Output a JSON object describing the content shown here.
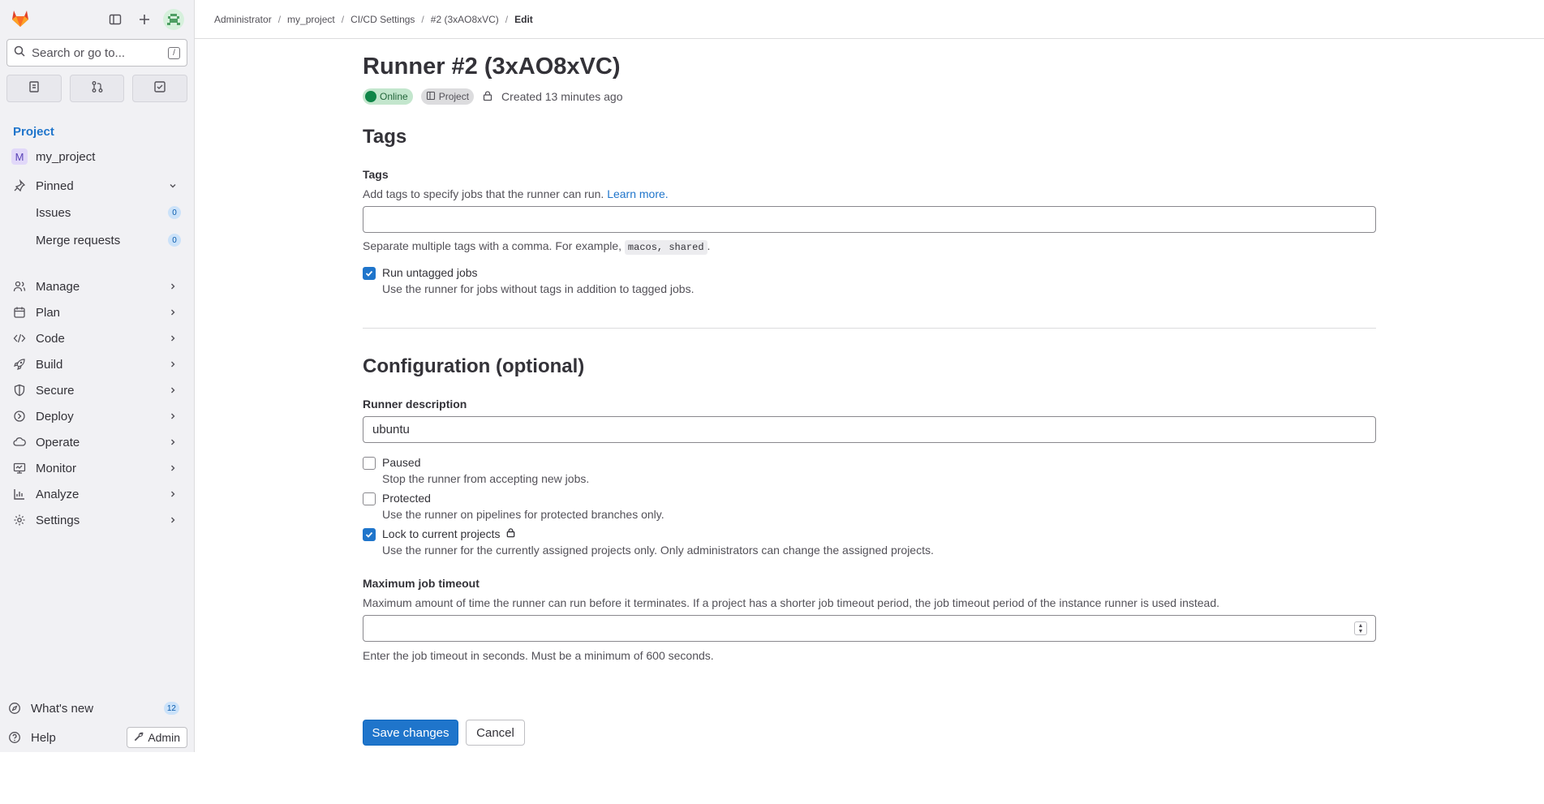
{
  "sidebar": {
    "search_placeholder": "Search or go to...",
    "search_shortcut": "/",
    "context_label": "Project",
    "project_initial": "M",
    "project_name": "my_project",
    "pinned_label": "Pinned",
    "pinned_items": [
      {
        "label": "Issues",
        "count": "0"
      },
      {
        "label": "Merge requests",
        "count": "0"
      }
    ],
    "menu": [
      {
        "label": "Manage",
        "icon": "users-icon"
      },
      {
        "label": "Plan",
        "icon": "calendar-icon"
      },
      {
        "label": "Code",
        "icon": "code-icon"
      },
      {
        "label": "Build",
        "icon": "rocket-icon"
      },
      {
        "label": "Secure",
        "icon": "shield-icon"
      },
      {
        "label": "Deploy",
        "icon": "deploy-icon"
      },
      {
        "label": "Operate",
        "icon": "cloud-gear-icon"
      },
      {
        "label": "Monitor",
        "icon": "monitor-icon"
      },
      {
        "label": "Analyze",
        "icon": "chart-icon"
      },
      {
        "label": "Settings",
        "icon": "gear-icon"
      }
    ],
    "whats_new_label": "What's new",
    "whats_new_count": "12",
    "help_label": "Help",
    "admin_label": "Admin"
  },
  "breadcrumb": [
    "Administrator",
    "my_project",
    "CI/CD Settings",
    "#2 (3xAO8xVC)",
    "Edit"
  ],
  "header": {
    "title": "Runner #2 (3xAO8xVC)",
    "status": "Online",
    "type": "Project",
    "created": "Created 13 minutes ago"
  },
  "tags_section": {
    "heading": "Tags",
    "label": "Tags",
    "help": "Add tags to specify jobs that the runner can run.",
    "learn_more": "Learn more.",
    "value": "",
    "hint_prefix": "Separate multiple tags with a comma. For example,",
    "hint_code": "macos, shared",
    "hint_suffix": ".",
    "run_untagged_label": "Run untagged jobs",
    "run_untagged_help": "Use the runner for jobs without tags in addition to tagged jobs.",
    "run_untagged_checked": true
  },
  "config_section": {
    "heading": "Configuration (optional)",
    "description_label": "Runner description",
    "description_value": "ubuntu",
    "paused_label": "Paused",
    "paused_help": "Stop the runner from accepting new jobs.",
    "paused_checked": false,
    "protected_label": "Protected",
    "protected_help": "Use the runner on pipelines for protected branches only.",
    "protected_checked": false,
    "lock_label": "Lock to current projects",
    "lock_help": "Use the runner for the currently assigned projects only. Only administrators can change the assigned projects.",
    "lock_checked": true,
    "timeout_label": "Maximum job timeout",
    "timeout_help": "Maximum amount of time the runner can run before it terminates. If a project has a shorter job timeout period, the job timeout period of the instance runner is used instead.",
    "timeout_value": "",
    "timeout_hint": "Enter the job timeout in seconds. Must be a minimum of 600 seconds."
  },
  "actions": {
    "save": "Save changes",
    "cancel": "Cancel"
  },
  "colors": {
    "accent": "#1f75cb",
    "online": "#108548",
    "sidebar_bg": "#f1f1f4"
  }
}
